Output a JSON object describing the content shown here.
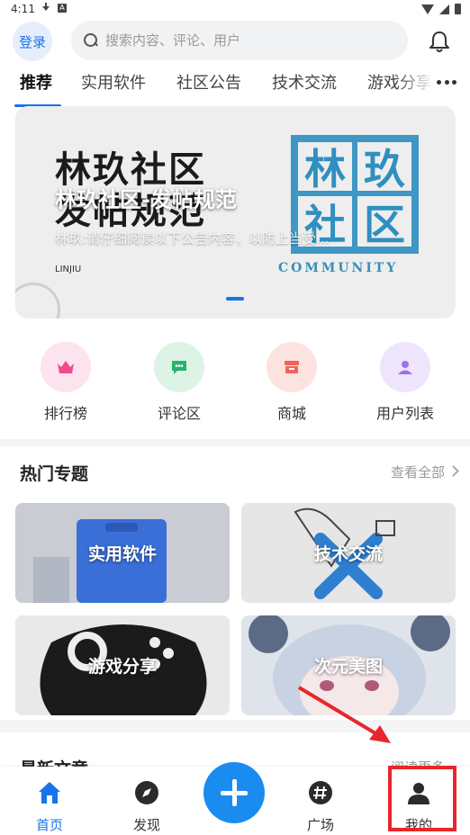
{
  "status_bar": {
    "time": "4:11",
    "a_badge": "A"
  },
  "topbar": {
    "login_label": "登录",
    "search_placeholder": "搜索内容、评论、用户"
  },
  "tabs": [
    {
      "label": "推荐",
      "active": true
    },
    {
      "label": "实用软件",
      "active": false
    },
    {
      "label": "社区公告",
      "active": false
    },
    {
      "label": "技术交流",
      "active": false
    },
    {
      "label": "游戏分享",
      "active": false
    }
  ],
  "banner": {
    "art_text_line1": "林玖社区",
    "art_text_line2": "发帖规范",
    "art_small": "LINJIU",
    "stamp_chars": [
      "林",
      "玖",
      "社",
      "区"
    ],
    "community_text": "COMMUNITY",
    "title": "林玖社区-发帖规范",
    "subtitle": "林玖:请仔细阅读以下公告内容，以防上当受..."
  },
  "quick_actions": [
    {
      "label": "排行榜",
      "icon": "crown-icon",
      "bg": "#fde3ee",
      "color": "#f04a8e"
    },
    {
      "label": "评论区",
      "icon": "comment-icon",
      "bg": "#ddf3e6",
      "color": "#27b36a"
    },
    {
      "label": "商城",
      "icon": "shop-icon",
      "bg": "#fde3df",
      "color": "#f0635a"
    },
    {
      "label": "用户列表",
      "icon": "user-icon",
      "bg": "#eee4fb",
      "color": "#a070e8"
    }
  ],
  "hot_topics": {
    "title": "热门专题",
    "more_label": "查看全部",
    "cards": [
      {
        "label": "实用软件"
      },
      {
        "label": "技术交流"
      },
      {
        "label": "游戏分享"
      },
      {
        "label": "次元美图"
      }
    ]
  },
  "latest": {
    "title": "最新文章",
    "more_label": "阅读更多"
  },
  "bottom_nav": [
    {
      "label": "首页",
      "active": true
    },
    {
      "label": "发现",
      "active": false
    },
    {
      "label": "广场",
      "active": false
    },
    {
      "label": "我的",
      "active": false
    }
  ],
  "colors": {
    "accent": "#1a73e8",
    "highlight": "#e8262b"
  }
}
